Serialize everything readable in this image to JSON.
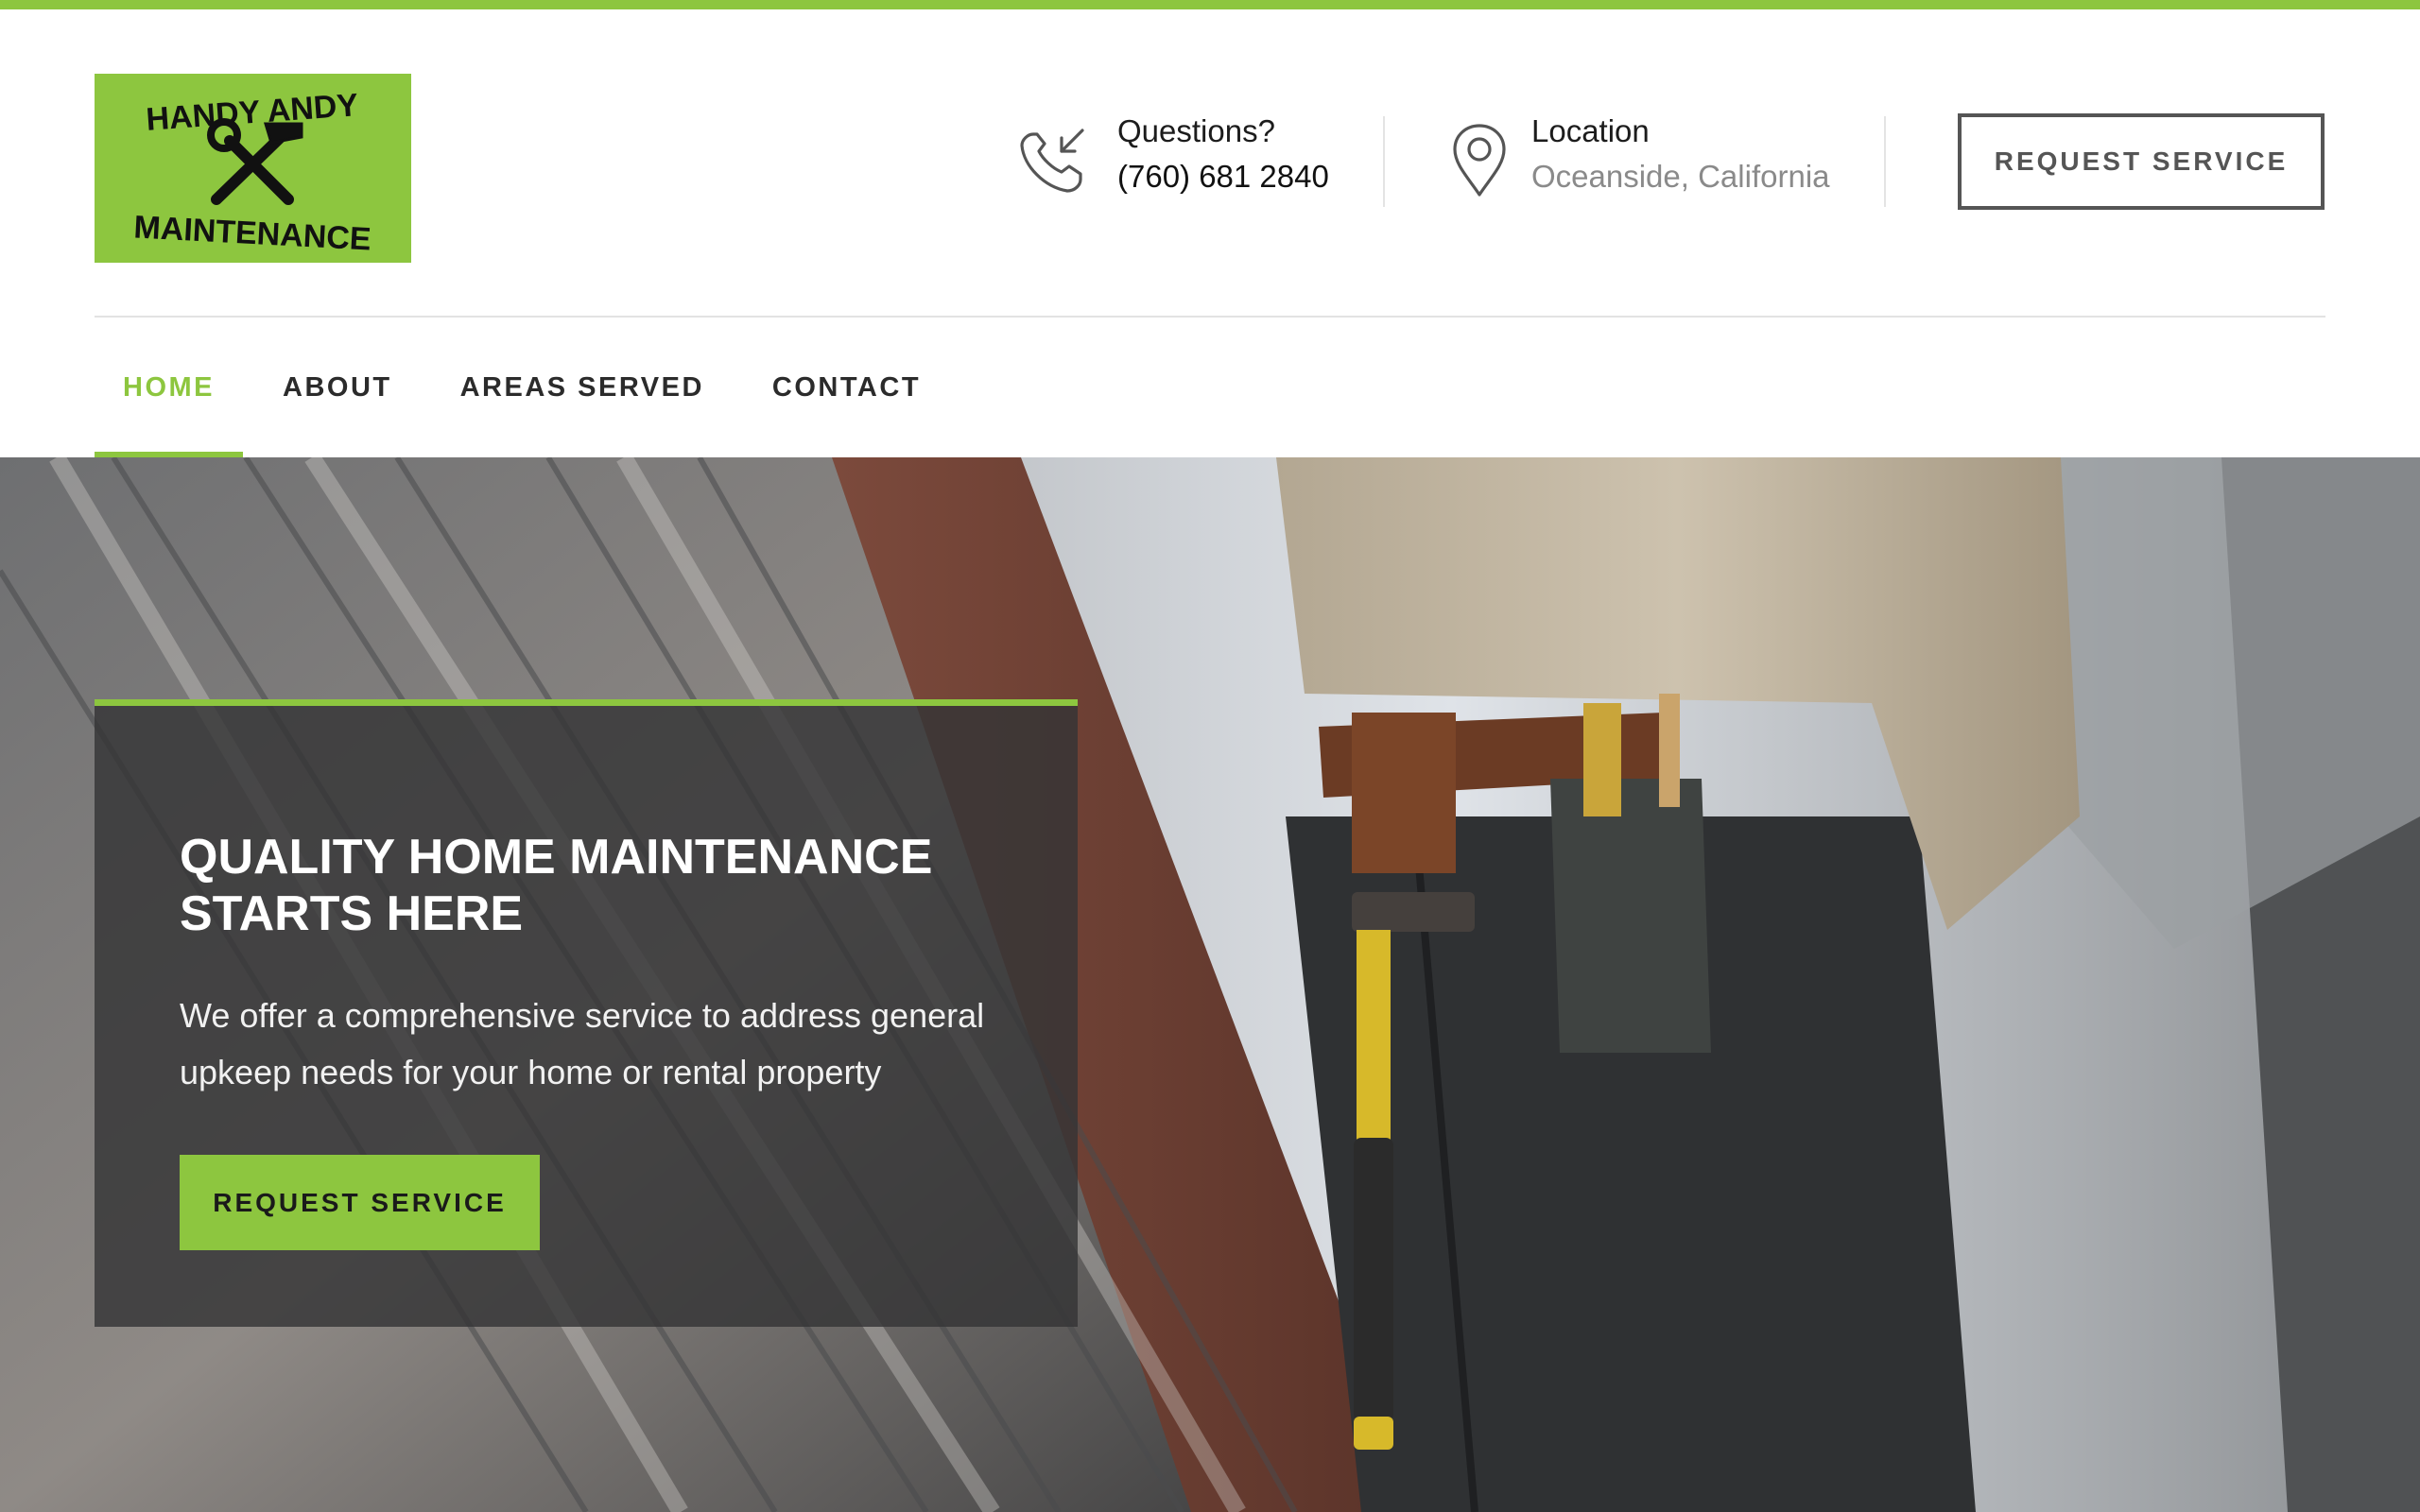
{
  "brand": {
    "logo_line1": "HANDY ANDY",
    "logo_line2": "MAINTENANCE",
    "accent_color": "#8dc63f"
  },
  "header": {
    "phone": {
      "icon": "phone-incoming-icon",
      "label": "Questions?",
      "value": "(760) 681 2840"
    },
    "location": {
      "icon": "map-pin-icon",
      "label": "Location",
      "value": "Oceanside, California"
    },
    "cta_label": "REQUEST SERVICE"
  },
  "nav": {
    "items": [
      {
        "label": "HOME",
        "active": true
      },
      {
        "label": "ABOUT",
        "active": false
      },
      {
        "label": "AREAS SERVED",
        "active": false
      },
      {
        "label": "CONTACT",
        "active": false
      }
    ]
  },
  "hero": {
    "title": "QUALITY HOME MAINTENANCE STARTS HERE",
    "body": "We offer a comprehensive service to address general upkeep needs for your home or rental property",
    "cta_label": "REQUEST SERVICE"
  }
}
